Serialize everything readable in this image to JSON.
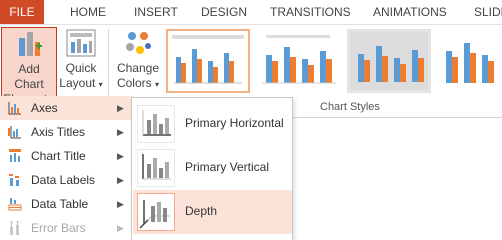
{
  "ribbon_tabs": [
    "FILE",
    "HOME",
    "INSERT",
    "DESIGN",
    "TRANSITIONS",
    "ANIMATIONS",
    "SLIDE"
  ],
  "ribbon": {
    "add_chart_element": {
      "line1": "Add Chart",
      "line2": "Element",
      "arrow": "▾"
    },
    "quick_layout": {
      "line1": "Quick",
      "line2": "Layout",
      "arrow": "▾"
    },
    "change_colors": {
      "line1": "Change",
      "line2": "Colors",
      "arrow": "▾"
    },
    "group_label": "Chart Styles"
  },
  "menu": {
    "items": [
      {
        "label": "Axes",
        "icon": "axes-icon",
        "state": "highlighted"
      },
      {
        "label": "Axis Titles",
        "icon": "axis-titles-icon",
        "state": "normal"
      },
      {
        "label": "Chart Title",
        "icon": "chart-title-icon",
        "state": "normal"
      },
      {
        "label": "Data Labels",
        "icon": "data-labels-icon",
        "state": "normal"
      },
      {
        "label": "Data Table",
        "icon": "data-table-icon",
        "state": "normal"
      },
      {
        "label": "Error Bars",
        "icon": "error-bars-icon",
        "state": "disabled"
      }
    ],
    "arrow": "▶"
  },
  "submenu": {
    "items": [
      {
        "label": "Primary Horizontal",
        "icon": "primary-horizontal-axis-icon",
        "state": "normal"
      },
      {
        "label": "Primary Vertical",
        "icon": "primary-vertical-axis-icon",
        "state": "normal"
      },
      {
        "label": "Depth",
        "icon": "depth-axis-icon",
        "state": "highlighted"
      }
    ]
  },
  "colors": {
    "file_tab": "#d04a26",
    "active_border": "#c23a22",
    "highlight_bg": "#fce3d9",
    "selected_thumb_border": "#f4b183",
    "bar_blue": "#5b9bd5",
    "bar_orange": "#ed7d31",
    "bar_gray": "#a5a5a5"
  }
}
